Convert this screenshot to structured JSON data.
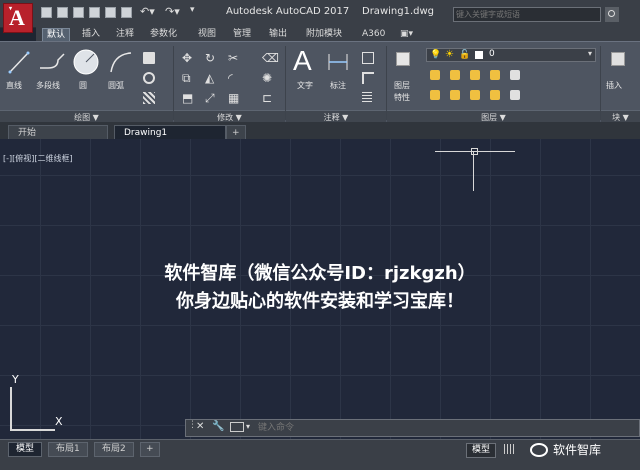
{
  "titlebar": {
    "app_title": "Autodesk AutoCAD 2017",
    "doc_name": "Drawing1.dwg",
    "search_placeholder": "键入关键字或短语",
    "logo": "A"
  },
  "ribbon_tabs": [
    "默认",
    "插入",
    "注释",
    "参数化",
    "视图",
    "管理",
    "输出",
    "附加模块",
    "A360"
  ],
  "ribbon_active_tab": "默认",
  "panels": {
    "draw": {
      "label": "绘图 ▼",
      "tools": [
        "直线",
        "多段线",
        "圆",
        "圆弧"
      ]
    },
    "modify": {
      "label": "修改 ▼"
    },
    "annotation": {
      "label": "注释 ▼",
      "tools": [
        "文字",
        "标注"
      ]
    },
    "layers": {
      "label": "图层 ▼",
      "tool_line1": "图层",
      "tool_line2": "特性",
      "layer_value": "0"
    },
    "block": {
      "label": "块 ▼",
      "insert": "插入"
    }
  },
  "file_tabs": [
    "开始",
    "Drawing1"
  ],
  "file_tab_add": "+",
  "canvas": {
    "viewport_label": "[-][俯视][二维线框]",
    "overlay_line1": "软件智库（微信公众号ID：rjzkgzh）",
    "overlay_line2": "你身边贴心的软件安装和学习宝库！",
    "ucs_x": "X",
    "ucs_y": "Y"
  },
  "command_line": {
    "placeholder": "键入命令",
    "close": "✕"
  },
  "layout_tabs": [
    "模型",
    "布局1",
    "布局2"
  ],
  "layout_add": "+",
  "status": {
    "model": "模型",
    "watermark": "软件智库"
  },
  "colors": {
    "canvas": "#21283a",
    "ribbon": "#4e5561",
    "logo": "#b8212b"
  }
}
